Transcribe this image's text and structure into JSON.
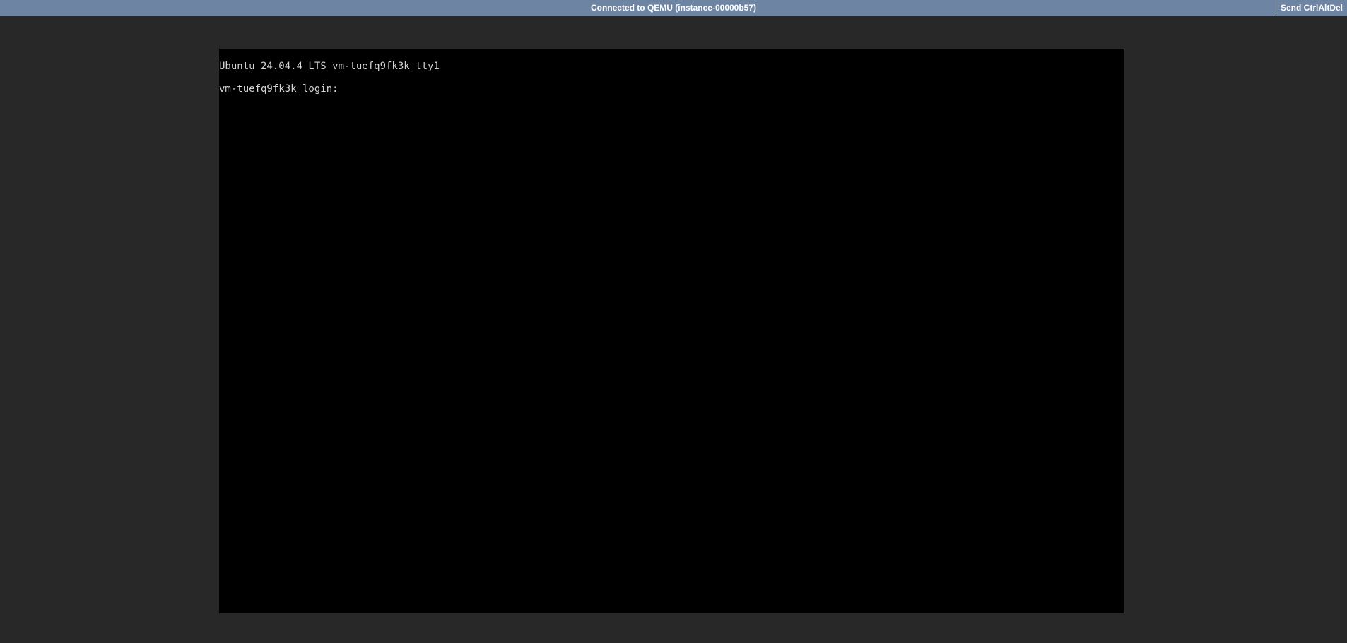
{
  "status_bar": {
    "status_text": "Connected to QEMU (instance-00000b57)",
    "send_cad_label": "Send CtrlAltDel",
    "background_color": "#6e84a3"
  },
  "console": {
    "lines": [
      "Ubuntu 24.04.4 LTS vm-tuefq9fk3k tty1",
      "vm-tuefq9fk3k login: "
    ],
    "background_color": "#000000",
    "text_color": "#d4d4d4"
  }
}
